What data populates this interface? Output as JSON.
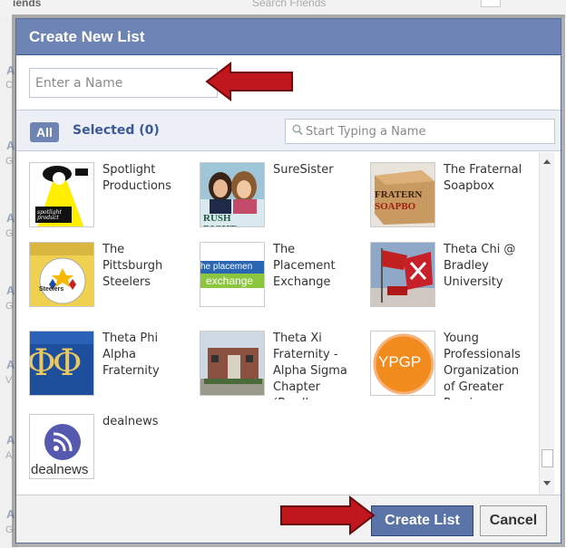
{
  "background": {
    "friends_label": "iends",
    "search_placeholder": "Search Friends",
    "side_letters": [
      "A",
      "C",
      "A",
      "G",
      "A",
      "G",
      "A",
      "G",
      "A",
      "V",
      "A",
      "A",
      "A",
      "G"
    ]
  },
  "dialog": {
    "title": "Create New List",
    "name_placeholder": "Enter a Name",
    "tabs": {
      "all_label": "All",
      "selected_label": "Selected (0)"
    },
    "search_placeholder": "Start Typing a Name",
    "items": [
      {
        "label": "Spotlight Productions",
        "icon": "spotlight-thumb"
      },
      {
        "label": "SureSister",
        "icon": "suresister-thumb"
      },
      {
        "label": "The Fraternal Soapbox",
        "icon": "fraternal-soapbox-thumb"
      },
      {
        "label": "The Pittsburgh Steelers",
        "icon": "steelers-thumb"
      },
      {
        "label": "The Placement Exchange",
        "icon": "placement-exchange-thumb"
      },
      {
        "label": "Theta Chi @ Bradley University",
        "icon": "theta-chi-thumb"
      },
      {
        "label": "Theta Phi Alpha Fraternity",
        "icon": "theta-phi-alpha-thumb"
      },
      {
        "label": "Theta Xi Fraternity - Alpha Sigma Chapter (Bradley",
        "icon": "theta-xi-thumb"
      },
      {
        "label": "Young Professionals Organization of Greater Peoria",
        "icon": "ypgp-thumb"
      },
      {
        "label": "dealnews",
        "icon": "dealnews-thumb"
      }
    ],
    "thumb_text": {
      "spotlight": "spotlight product",
      "rush_right": "RUSH RIGHT",
      "fraternal_top": "FRATERN",
      "fraternal_bottom": "SOAPBO",
      "steelers": "Steelers",
      "placement_top": "he placemen",
      "placement_bottom": "exchange",
      "phi": "ΦΦ",
      "ypgp": "YPGP",
      "dealnews": "dealnews"
    },
    "buttons": {
      "create_label": "Create List",
      "cancel_label": "Cancel"
    }
  },
  "colors": {
    "title_bar": "#6d84b4",
    "link_blue": "#3b5998",
    "arrow_red": "#c0161d"
  }
}
